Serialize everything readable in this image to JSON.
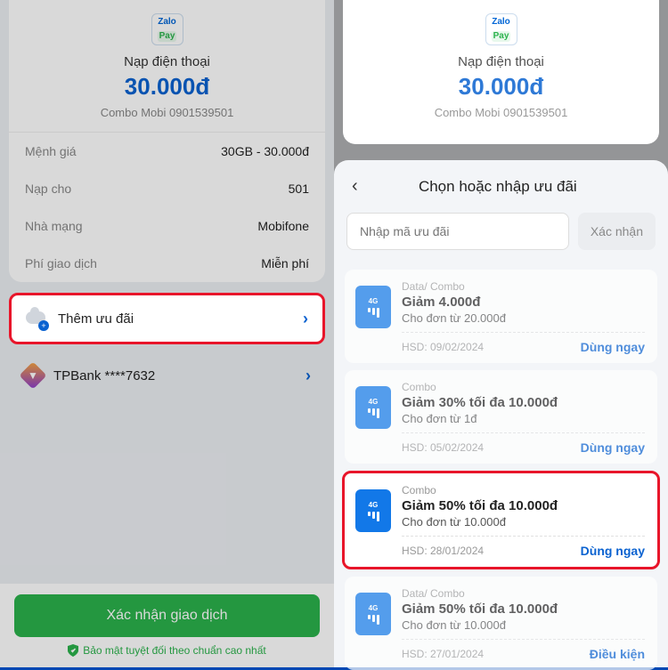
{
  "left": {
    "header": {
      "logo_top": "Zalo",
      "logo_bot": "Pay",
      "title": "Nạp điện thoại",
      "amount": "30.000đ",
      "subtitle": "Combo Mobi 0901539501"
    },
    "rows": [
      {
        "label": "Mệnh giá",
        "val": "30GB - 30.000đ"
      },
      {
        "label": "Nạp cho",
        "val": "501"
      },
      {
        "label": "Nhà mạng",
        "val": "Mobifone"
      },
      {
        "label": "Phí giao dịch",
        "val": "Miễn phí"
      }
    ],
    "add_offer": "Thêm ưu đãi",
    "bank": "TPBank ****7632",
    "confirm": "Xác nhận giao dịch",
    "secure": "Bảo mật tuyệt đối theo chuẩn cao nhất"
  },
  "right": {
    "header": {
      "logo_top": "Zalo",
      "logo_bot": "Pay",
      "title": "Nạp điện thoại",
      "amount": "30.000đ",
      "subtitle": "Combo Mobi 0901539501"
    },
    "sheet": {
      "title": "Chọn hoặc nhập ưu đãi",
      "placeholder": "Nhập mã ưu đãi",
      "confirm": "Xác nhận",
      "vouchers": [
        {
          "cat": "Data/ Combo",
          "title": "Giảm 4.000đ",
          "sub": "Cho đơn từ 20.000đ",
          "exp": "HSD: 09/02/2024",
          "act": "Dùng ngay",
          "hl": false,
          "icon": "wifi"
        },
        {
          "cat": "Combo",
          "title": "Giảm 30% tối đa 10.000đ",
          "sub": "Cho đơn từ 1đ",
          "exp": "HSD: 05/02/2024",
          "act": "Dùng ngay",
          "hl": false,
          "icon": "bars"
        },
        {
          "cat": "Combo",
          "title": "Giảm 50% tối đa 10.000đ",
          "sub": "Cho đơn từ 10.000đ",
          "exp": "HSD: 28/01/2024",
          "act": "Dùng ngay",
          "hl": true,
          "icon": "bars"
        },
        {
          "cat": "Data/ Combo",
          "title": "Giảm 50% tối đa 10.000đ",
          "sub": "Cho đơn từ 10.000đ",
          "exp": "HSD: 27/01/2024",
          "act": "Điều kiện",
          "hl": false,
          "icon": "wifi"
        }
      ]
    }
  }
}
